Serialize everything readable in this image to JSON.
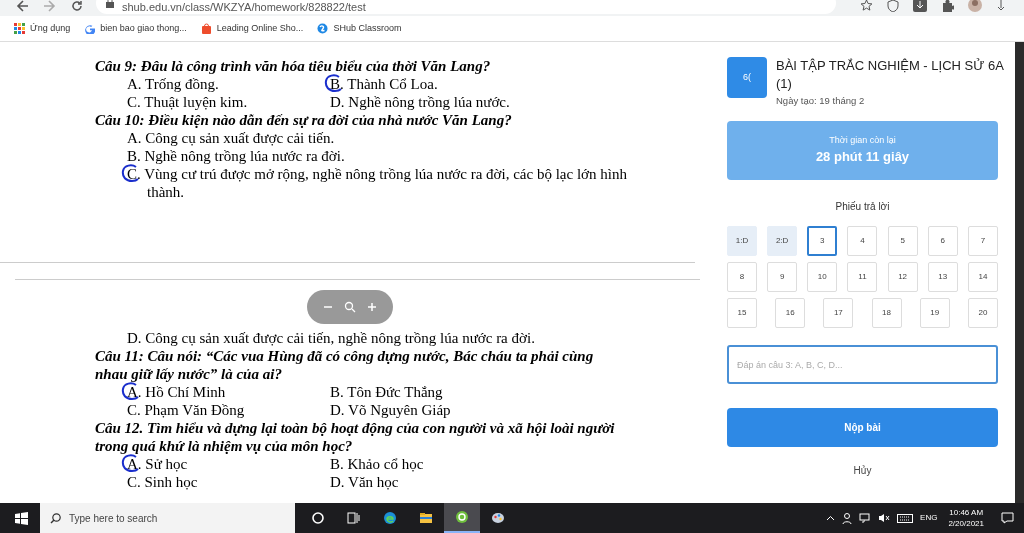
{
  "browser": {
    "url": "shub.edu.vn/class/WKZYA/homework/828822/test",
    "bookmarks": [
      {
        "kind": "apps",
        "label": "Ứng dụng"
      },
      {
        "kind": "google",
        "label": "bien bao giao thong..."
      },
      {
        "kind": "shop",
        "label": "Leading Online Sho..."
      },
      {
        "kind": "shub",
        "label": "SHub Classroom"
      }
    ]
  },
  "document": {
    "pages": [
      {
        "blocks": [
          {
            "kind": "question",
            "text": "Câu 9: Đâu là công trình văn hóa tiêu biểu của thời Văn Lang?"
          },
          {
            "kind": "options",
            "options": [
              {
                "text": "A. Trống đồng.",
                "circled": false
              },
              {
                "text": "B. Thành Cổ Loa.",
                "circled": true
              }
            ]
          },
          {
            "kind": "options",
            "options": [
              {
                "text": "C. Thuật luyện kim.",
                "circled": false
              },
              {
                "text": "D. Nghề nông trồng lúa nước.",
                "circled": false
              }
            ]
          },
          {
            "kind": "question",
            "text": "Câu 10: Điều kiện nào dẫn đến sự ra đời của nhà nước Văn Lang?"
          },
          {
            "kind": "options",
            "options": [
              {
                "text": "A. Công cụ sản xuất được cải tiến.",
                "circled": false
              }
            ]
          },
          {
            "kind": "options",
            "options": [
              {
                "text": "B. Nghề nông trồng lúa nước ra đời.",
                "circled": false
              }
            ]
          },
          {
            "kind": "options",
            "options": [
              {
                "text": "C. Vùng cư trú được mở rộng, nghề nông trồng lúa nước ra đời, các bộ lạc lớn hình thành.",
                "circled": true
              }
            ]
          }
        ]
      },
      {
        "blocks": [
          {
            "kind": "options",
            "options": [
              {
                "text": "D. Công cụ sản xuất được cải tiến, nghề nông trồng lúa nước ra đời.",
                "circled": false
              }
            ]
          },
          {
            "kind": "question",
            "text": "Câu 11: Câu nói: “Các vua Hùng đã có công dựng nước, Bác cháu ta phải cùng nhau giữ lấy nước” là của ai?"
          },
          {
            "kind": "options",
            "options": [
              {
                "text": "A. Hồ Chí Minh",
                "circled": true
              },
              {
                "text": "B. Tôn Đức Thắng",
                "circled": false
              }
            ]
          },
          {
            "kind": "options",
            "options": [
              {
                "text": "C. Phạm Văn Đồng",
                "circled": false
              },
              {
                "text": "D. Võ Nguyên Giáp",
                "circled": false
              }
            ]
          },
          {
            "kind": "question",
            "text": "Câu 12. Tìm hiểu và dựng lại toàn bộ hoạt động của con người và xã hội loài người trong quá khứ là nhiệm vụ của môn học?"
          },
          {
            "kind": "options",
            "options": [
              {
                "text": "A. Sử học",
                "circled": true
              },
              {
                "text": "B. Khảo cổ học",
                "circled": false
              }
            ]
          },
          {
            "kind": "options",
            "options": [
              {
                "text": "C. Sinh học",
                "circled": false
              },
              {
                "text": "D. Văn học",
                "circled": false
              }
            ]
          }
        ]
      }
    ]
  },
  "panel": {
    "logo": "6(",
    "title": "BÀI TẬP TRẮC NGHIỆM - LỊCH SỬ 6A (1)",
    "created": "Ngày tạo: 19 tháng 2",
    "timer": {
      "label": "Thời gian còn lại",
      "value": "28 phút 11 giây"
    },
    "sheet_title": "Phiếu trả lời",
    "cells": [
      {
        "label": "1:D",
        "answered": true,
        "selected": false
      },
      {
        "label": "2:D",
        "answered": true,
        "selected": false
      },
      {
        "label": "3",
        "answered": false,
        "selected": true
      },
      {
        "label": "4",
        "answered": false,
        "selected": false
      },
      {
        "label": "5",
        "answered": false,
        "selected": false
      },
      {
        "label": "6",
        "answered": false,
        "selected": false
      },
      {
        "label": "7",
        "answered": false,
        "selected": false
      },
      {
        "label": "8",
        "answered": false,
        "selected": false
      },
      {
        "label": "9",
        "answered": false,
        "selected": false
      },
      {
        "label": "10",
        "answered": false,
        "selected": false
      },
      {
        "label": "11",
        "answered": false,
        "selected": false
      },
      {
        "label": "12",
        "answered": false,
        "selected": false
      },
      {
        "label": "13",
        "answered": false,
        "selected": false
      },
      {
        "label": "14",
        "answered": false,
        "selected": false
      },
      {
        "label": "15",
        "answered": false,
        "selected": false
      },
      {
        "label": "16",
        "answered": false,
        "selected": false
      },
      {
        "label": "17",
        "answered": false,
        "selected": false
      },
      {
        "label": "18",
        "answered": false,
        "selected": false
      },
      {
        "label": "19",
        "answered": false,
        "selected": false
      },
      {
        "label": "20",
        "answered": false,
        "selected": false
      }
    ],
    "answer_field": {
      "placeholder": "Đáp án câu 3: A, B, C, D..."
    },
    "submit": "Nộp bài",
    "cancel": "Hủy"
  },
  "taskbar": {
    "search_placeholder": "Type here to search",
    "apps": [
      {
        "kind": "cortana",
        "selected": false
      },
      {
        "kind": "taskview",
        "selected": false
      },
      {
        "kind": "edge",
        "selected": false
      },
      {
        "kind": "folder",
        "selected": false
      },
      {
        "kind": "greenapp",
        "selected": true
      },
      {
        "kind": "paint",
        "selected": false
      }
    ],
    "language": "ENG",
    "time": "10:46 AM",
    "date": "2/20/2021"
  }
}
